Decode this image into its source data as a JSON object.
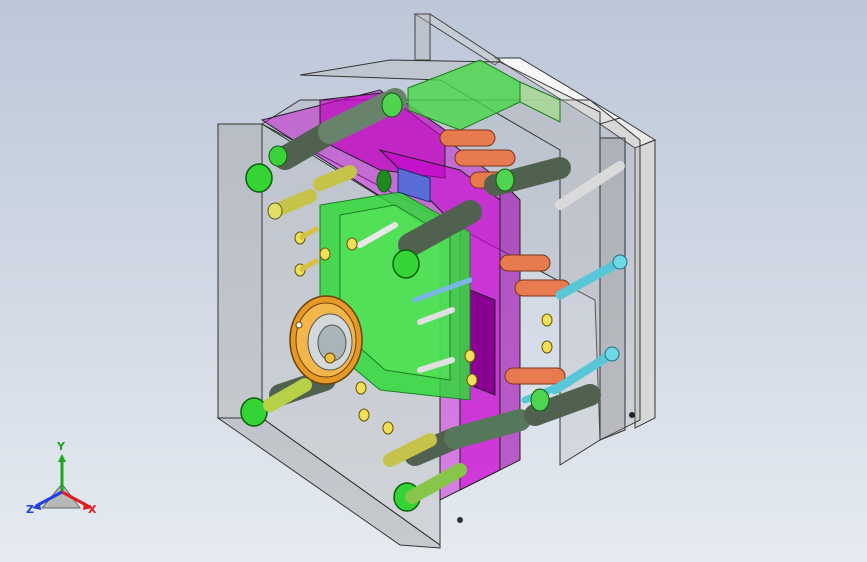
{
  "viewport": {
    "model": "injection-mold-assembly",
    "display_mode": "shaded-transparent"
  },
  "triad": {
    "labels": {
      "x": "X",
      "y": "Y",
      "z": "Z"
    },
    "colors": {
      "x": "#e02020",
      "y": "#18a818",
      "z": "#2040e0"
    }
  },
  "colors": {
    "plate": "#b400c8",
    "insert": "#28d23c",
    "steel": "#9aa0a6",
    "brass": "#d89a20",
    "copper": "#e87a50",
    "pin_cyan": "#58c8d8"
  }
}
